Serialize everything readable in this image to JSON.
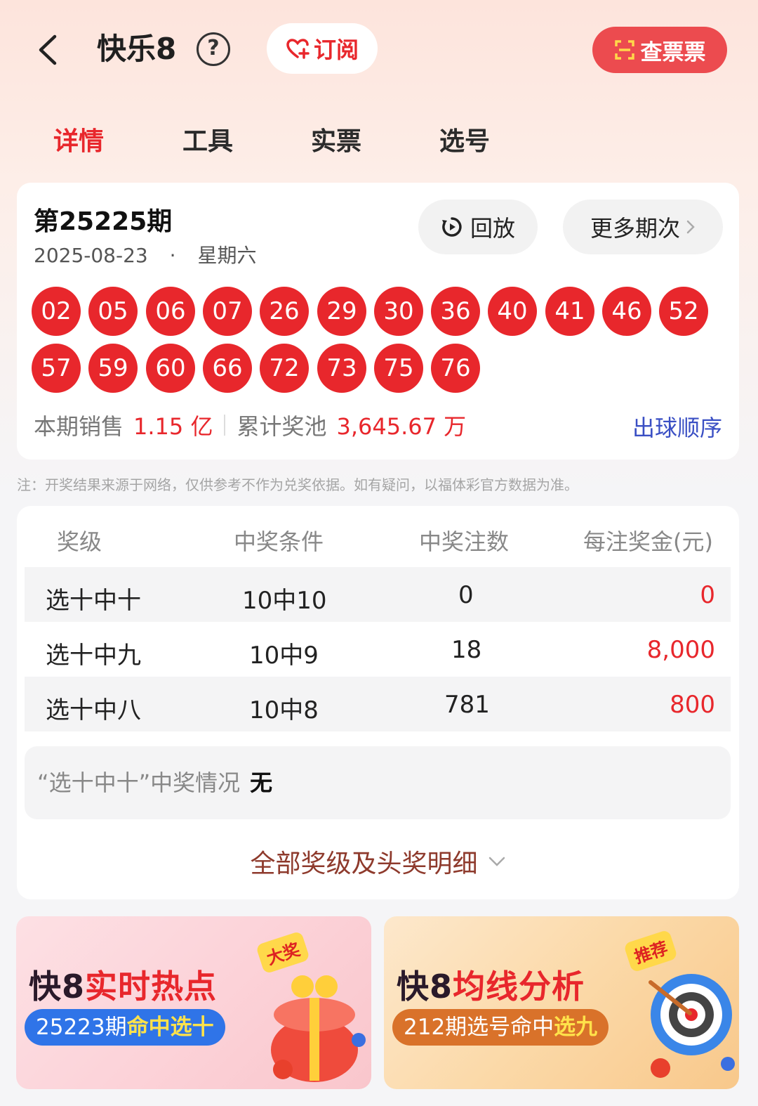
{
  "header": {
    "title": "快乐8",
    "help_label": "?",
    "subscribe_label": "订阅",
    "check_ticket_label": "查票票"
  },
  "tabs": [
    {
      "label": "详情",
      "active": true
    },
    {
      "label": "工具",
      "active": false
    },
    {
      "label": "实票",
      "active": false
    },
    {
      "label": "选号",
      "active": false
    }
  ],
  "draw": {
    "period": "第25225期",
    "date": "2025-08-23",
    "dot": "·",
    "weekday": "星期六",
    "replay_label": "回放",
    "more_label": "更多期次",
    "numbers": [
      "02",
      "05",
      "06",
      "07",
      "26",
      "29",
      "30",
      "36",
      "40",
      "41",
      "46",
      "52",
      "57",
      "59",
      "60",
      "66",
      "72",
      "73",
      "75",
      "76"
    ],
    "sales_label": "本期销售",
    "sales_value": "1.15 亿",
    "pool_label": "累计奖池",
    "pool_value": "3,645.67 万",
    "order_link": "出球顺序"
  },
  "note": "注：开奖结果来源于网络，仅供参考不作为兑奖依据。如有疑问，以福体彩官方数据为准。",
  "prize_table": {
    "headers": [
      "奖级",
      "中奖条件",
      "中奖注数",
      "每注奖金(元)"
    ],
    "rows": [
      {
        "level": "选十中十",
        "condition": "10中10",
        "count": "0",
        "prize": "0"
      },
      {
        "level": "选十中九",
        "condition": "10中9",
        "count": "18",
        "prize": "8,000"
      },
      {
        "level": "选十中八",
        "condition": "10中8",
        "count": "781",
        "prize": "800"
      }
    ],
    "winner_label": "“选十中十”中奖情况",
    "winner_value": "无",
    "all_prizes_label": "全部奖级及头奖明细"
  },
  "banners": [
    {
      "title_a": "快8",
      "title_b": "实时热点",
      "tag": "大奖",
      "sub_a": "25223期",
      "sub_b": "命中选十"
    },
    {
      "title_a": "快8",
      "title_b": "均线分析",
      "tag": "推荐",
      "sub_a": "212期选号命中",
      "sub_b": "选九"
    }
  ],
  "colors": {
    "accent": "#e8272c",
    "link": "#3a4fc4",
    "muted": "#888888"
  }
}
